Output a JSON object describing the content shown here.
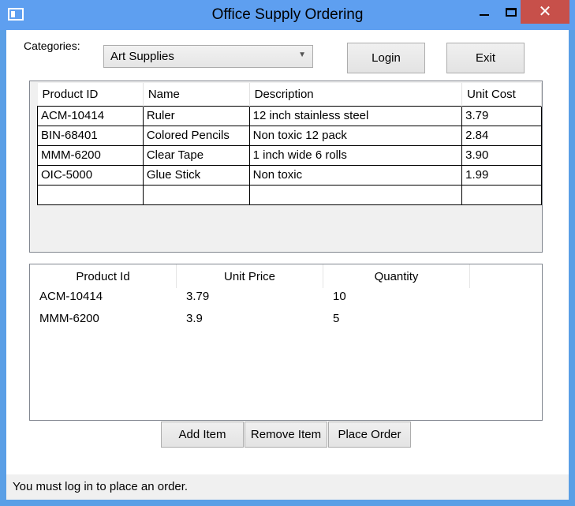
{
  "window": {
    "title": "Office Supply Ordering",
    "close_glyph": "✕"
  },
  "categories": {
    "label": "Categories:",
    "selected": "Art Supplies"
  },
  "buttons": {
    "login": "Login",
    "exit": "Exit",
    "add_item": "Add Item",
    "remove_item": "Remove Item",
    "place_order": "Place Order"
  },
  "products": {
    "headers": [
      "Product ID",
      "Name",
      "Description",
      "Unit Cost"
    ],
    "rows": [
      [
        "ACM-10414",
        "Ruler",
        "12 inch stainless steel",
        "3.79"
      ],
      [
        "BIN-68401",
        "Colored Pencils",
        "Non toxic 12 pack",
        "2.84"
      ],
      [
        "MMM-6200",
        "Clear Tape",
        "1 inch wide 6 rolls",
        "3.90"
      ],
      [
        "OIC-5000",
        "Glue Stick",
        "Non toxic",
        "1.99"
      ]
    ]
  },
  "orders": {
    "headers": [
      "Product Id",
      "Unit Price",
      "Quantity"
    ],
    "rows": [
      [
        "ACM-10414",
        "3.79",
        "10"
      ],
      [
        "MMM-6200",
        "3.9",
        "5"
      ]
    ]
  },
  "status": "You must log in to place an order."
}
